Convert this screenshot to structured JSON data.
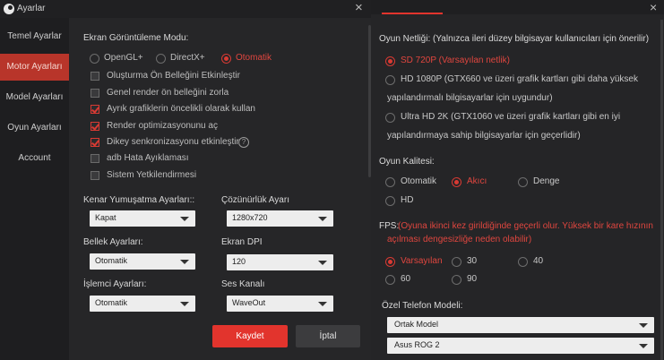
{
  "left_window": {
    "title": "Ayarlar",
    "close": "×",
    "sidebar": [
      {
        "label": "Temel Ayarlar",
        "active": false
      },
      {
        "label": "Motor Ayarları",
        "active": true
      },
      {
        "label": "Model Ayarları",
        "active": false
      },
      {
        "label": "Oyun Ayarları",
        "active": false
      },
      {
        "label": "Account",
        "active": false
      }
    ],
    "display_mode": {
      "heading": "Ekran Görüntüleme Modu:",
      "options": [
        "OpenGL+",
        "DirectX+",
        "Otomatik"
      ],
      "selected": "Otomatik"
    },
    "checkboxes": [
      {
        "label": "Oluşturma Ön Belleğini Etkinleştir",
        "checked": false
      },
      {
        "label": "Genel render ön belleğini zorla",
        "checked": false
      },
      {
        "label": "Ayrık grafiklerin öncelikli olarak kullan",
        "checked": true
      },
      {
        "label": "Render optimizasyonunu aç",
        "checked": true
      },
      {
        "label": "Dikey senkronizasyonu etkinleştir",
        "checked": true
      },
      {
        "label": "adb Hata Ayıklaması",
        "checked": false
      },
      {
        "label": "Sistem Yetkilendirmesi",
        "checked": false
      }
    ],
    "help": "?",
    "antialias": {
      "label": "Kenar Yumuşatma Ayarları::",
      "value": "Kapat"
    },
    "resolution": {
      "label": "Çözünürlük Ayarı",
      "value": "1280x720"
    },
    "memory": {
      "label": "Bellek Ayarları:",
      "value": "Otomatik"
    },
    "dpi": {
      "label": "Ekran DPI",
      "value": "120"
    },
    "cpu": {
      "label": "İşlemci Ayarları:",
      "value": "Otomatik"
    },
    "audio": {
      "label": "Ses Kanalı",
      "value": "WaveOut"
    },
    "save_label": "Kaydet",
    "cancel_label": "İptal"
  },
  "right_window": {
    "close": "×",
    "network": {
      "heading": "Oyun Netliği: (Yalnızca ileri düzey bilgisayar kullanıcıları için önerilir)",
      "options": [
        {
          "line1": "SD 720P (Varsayılan netlik)",
          "line2": "",
          "selected": true
        },
        {
          "line1": "HD 1080P (GTX660 ve üzeri grafik kartları gibi daha yüksek",
          "line2": "yapılandırmalı bilgisayarlar için uygundur)",
          "selected": false
        },
        {
          "line1": "Ultra HD 2K (GTX1060 ve üzeri grafik kartları gibi en iyi",
          "line2": "yapılandırmaya sahip bilgisayarlar için geçerlidir)",
          "selected": false
        }
      ]
    },
    "quality": {
      "heading": "Oyun Kalitesi:",
      "options": [
        "Otomatik",
        "Akıcı",
        "Denge",
        "HD"
      ],
      "selected": "Akıcı"
    },
    "fps": {
      "heading": "FPS:",
      "note_line1": "(Oyuna ikinci kez girildiğinde geçerli olur. Yüksek bir kare hızının",
      "note_line2": "açılması dengesizliğe neden olabilir)",
      "options": [
        "Varsayılan",
        "30",
        "40",
        "60",
        "90"
      ],
      "selected": "Varsayılan"
    },
    "phone_model": {
      "heading": "Özel Telefon Modeli:",
      "model_type": "Ortak Model",
      "model": "Asus ROG 2"
    }
  },
  "colors": {
    "accent": "#e2342d",
    "sidebar_active": "#b8352a"
  }
}
